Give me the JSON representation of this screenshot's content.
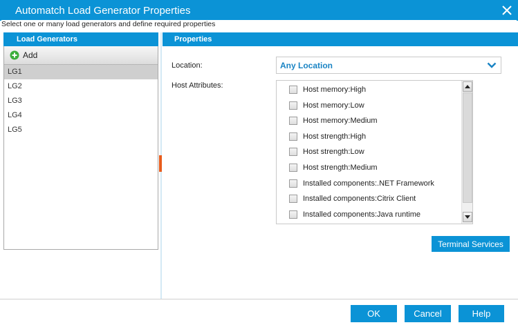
{
  "window": {
    "title": "Automatch Load Generator Properties",
    "subtitle": "Select one or many load generators and define required properties"
  },
  "left": {
    "header": "Load Generators",
    "add_label": "Add",
    "items": [
      "LG1",
      "LG2",
      "LG3",
      "LG4",
      "LG5"
    ],
    "selected": "LG1"
  },
  "right": {
    "header": "Properties",
    "location_label": "Location:",
    "location_value": "Any Location",
    "host_attributes_label": "Host Attributes:",
    "attributes": [
      "Host memory:High",
      "Host memory:Low",
      "Host memory:Medium",
      "Host strength:High",
      "Host strength:Low",
      "Host strength:Medium",
      "Installed components:.NET Framework",
      "Installed components:Citrix Client",
      "Installed components:Java runtime"
    ],
    "terminal_services_label": "Terminal Services"
  },
  "footer": {
    "ok_label": "OK",
    "cancel_label": "Cancel",
    "help_label": "Help"
  },
  "colors": {
    "accent": "#0b93d6",
    "link_text": "#1a84c4",
    "splitter_grip": "#e85c1c",
    "add_icon": "#3cae3c"
  },
  "icons": {
    "close": "close-icon",
    "add": "plus-circle-icon",
    "dropdown": "chevron-down-icon",
    "scroll_up": "arrow-up-icon",
    "scroll_down": "arrow-down-icon"
  }
}
